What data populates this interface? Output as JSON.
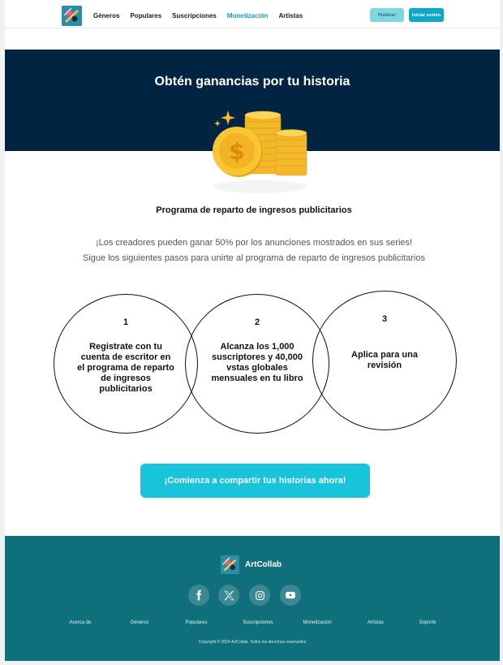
{
  "header": {
    "nav": [
      "Géneros",
      "Populares",
      "Suscripciones",
      "Monetización",
      "Artistas"
    ],
    "active_nav": "Monetización",
    "publish_label": "Publicar",
    "login_label": "Iniciar sesión"
  },
  "hero": {
    "title": "Obtén ganancias por tu historia"
  },
  "program": {
    "title": "Programa de reparto de ingresos publicitarios",
    "line1": "¡Los creadores pueden ganar  50% por los anunciones mostrados en sus series!",
    "line2": "Sigue los siguientes pasos para  unirte al programa de reparto de ingresos publicitarios"
  },
  "steps": [
    {
      "number": "1",
      "text": "Registrate con tu cuenta de escritor en el programa de reparto de ingresos publicitarios"
    },
    {
      "number": "2",
      "text": "Alcanza los 1,000 suscriptores y 40,000 vstas globales mensuales en tu libro"
    },
    {
      "number": "3",
      "text": "Aplica para una revisión"
    }
  ],
  "cta": {
    "label": "¡Comienza a compartir tus historias ahora!"
  },
  "footer": {
    "brand": "ArtCollab",
    "social": [
      "facebook-icon",
      "x-icon",
      "instagram-icon",
      "youtube-icon"
    ],
    "links": [
      "Acerca de",
      "Géneros",
      "Populares",
      "Suscripciones",
      "Monetización",
      "Artistas",
      "Soporte"
    ],
    "copyright": "Copyright © 2024 ArtCollab.    Todos los derechos reservados"
  },
  "colors": {
    "hero_bg": "#012442",
    "accent": "#18c4dc",
    "footer_bg": "#0f6f7a",
    "active_nav": "#14a0ae"
  }
}
